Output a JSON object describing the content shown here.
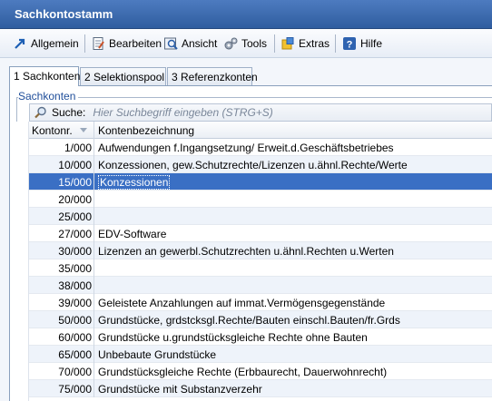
{
  "window": {
    "title": "Sachkontostamm"
  },
  "toolbar": {
    "items": [
      {
        "label": "Allgemein",
        "icon": "arrow-icon"
      },
      {
        "label": "Bearbeiten",
        "icon": "document-icon"
      },
      {
        "label": "Ansicht",
        "icon": "view-icon"
      },
      {
        "label": "Tools",
        "icon": "gear-icon"
      },
      {
        "label": "Extras",
        "icon": "extras-icon"
      },
      {
        "label": "Hilfe",
        "icon": "help-icon"
      }
    ]
  },
  "tabs": [
    {
      "label": "1 Sachkonten",
      "active": true
    },
    {
      "label": "2 Selektionspool",
      "active": false
    },
    {
      "label": "3 Referenzkonten",
      "active": false
    }
  ],
  "group": {
    "label": "Sachkonten"
  },
  "search": {
    "label": "Suche:",
    "placeholder": "Hier Suchbegriff eingeben (STRG+S)"
  },
  "grid": {
    "columns": [
      "Kontonr.",
      "Kontenbezeichnung"
    ],
    "rows": [
      {
        "nr": "1/000",
        "name": "Aufwendungen f.Ingangsetzung/ Erweit.d.Geschäftsbetriebes"
      },
      {
        "nr": "10/000",
        "name": "Konzessionen, gew.Schutzrechte/Lizenzen u.ähnl.Rechte/Werte"
      },
      {
        "nr": "15/000",
        "name": "Konzessionen",
        "selected": true
      },
      {
        "nr": "20/000",
        "name": ""
      },
      {
        "nr": "25/000",
        "name": ""
      },
      {
        "nr": "27/000",
        "name": "EDV-Software"
      },
      {
        "nr": "30/000",
        "name": "Lizenzen an gewerbl.Schutzrechten u.ähnl.Rechten u.Werten"
      },
      {
        "nr": "35/000",
        "name": ""
      },
      {
        "nr": "38/000",
        "name": ""
      },
      {
        "nr": "39/000",
        "name": "Geleistete Anzahlungen auf immat.Vermögensgegenstände"
      },
      {
        "nr": "50/000",
        "name": "Grundstücke, grdstcksgl.Rechte/Bauten einschl.Bauten/fr.Grds"
      },
      {
        "nr": "60/000",
        "name": "Grundstücke u.grundstücksgleiche Rechte ohne Bauten"
      },
      {
        "nr": "65/000",
        "name": "Unbebaute Grundstücke"
      },
      {
        "nr": "70/000",
        "name": "Grundstücksgleiche Rechte (Erbbaurecht, Dauerwohnrecht)"
      },
      {
        "nr": "75/000",
        "name": "Grundstücke mit Substanzverzehr"
      }
    ]
  },
  "colors": {
    "title_bar": "#3a69ad",
    "selection": "#3a6fc4",
    "group_label": "#1f4e9a"
  }
}
